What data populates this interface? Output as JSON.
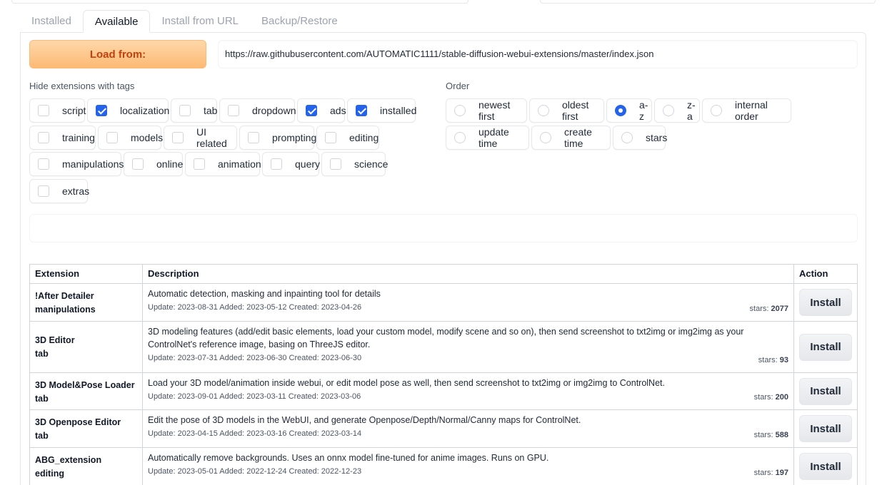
{
  "tabs": [
    {
      "label": "Installed"
    },
    {
      "label": "Available"
    },
    {
      "label": "Install from URL"
    },
    {
      "label": "Backup/Restore"
    }
  ],
  "load": {
    "button_label": "Load from:",
    "url": "https://raw.githubusercontent.com/AUTOMATIC1111/stable-diffusion-webui-extensions/master/index.json"
  },
  "hide_tags": {
    "label": "Hide extensions with tags",
    "items": [
      {
        "label": "script",
        "checked": false
      },
      {
        "label": "localization",
        "checked": true
      },
      {
        "label": "tab",
        "checked": false
      },
      {
        "label": "dropdown",
        "checked": false
      },
      {
        "label": "ads",
        "checked": true
      },
      {
        "label": "installed",
        "checked": true
      },
      {
        "label": "training",
        "checked": false
      },
      {
        "label": "models",
        "checked": false
      },
      {
        "label": "UI related",
        "checked": false
      },
      {
        "label": "prompting",
        "checked": false
      },
      {
        "label": "editing",
        "checked": false
      },
      {
        "label": "manipulations",
        "checked": false
      },
      {
        "label": "online",
        "checked": false
      },
      {
        "label": "animation",
        "checked": false
      },
      {
        "label": "query",
        "checked": false
      },
      {
        "label": "science",
        "checked": false
      },
      {
        "label": "extras",
        "checked": false
      }
    ]
  },
  "order": {
    "label": "Order",
    "selected": "a-z",
    "items": [
      {
        "label": "newest first"
      },
      {
        "label": "oldest first"
      },
      {
        "label": "a-z"
      },
      {
        "label": "z-a"
      },
      {
        "label": "internal order"
      },
      {
        "label": "update time"
      },
      {
        "label": "create time"
      },
      {
        "label": "stars"
      }
    ]
  },
  "table": {
    "headers": {
      "extension": "Extension",
      "description": "Description",
      "action": "Action"
    },
    "stars_label": "stars:",
    "install_label": "Install",
    "rows": [
      {
        "name": "!After Detailer",
        "tag": "manipulations",
        "description": "Automatic detection, masking and inpainting tool for details",
        "meta": "Update: 2023-08-31 Added: 2023-05-12 Created: 2023-04-26",
        "stars": "2077"
      },
      {
        "name": "3D Editor",
        "tag": "tab",
        "description": "3D modeling features (add/edit basic elements, load your custom model, modify scene and so on), then send screenshot to txt2img or img2img as your ControlNet's reference image, basing on ThreeJS editor.",
        "meta": "Update: 2023-07-31 Added: 2023-06-30 Created: 2023-06-30",
        "stars": "93"
      },
      {
        "name": "3D Model&Pose Loader",
        "tag": "tab",
        "description": "Load your 3D model/animation inside webui, or edit model pose as well, then send screenshot to txt2img or img2img to ControlNet.",
        "meta": "Update: 2023-09-01 Added: 2023-03-11 Created: 2023-03-06",
        "stars": "200"
      },
      {
        "name": "3D Openpose Editor",
        "tag": "tab",
        "description": "Edit the pose of 3D models in the WebUI, and generate Openpose/Depth/Normal/Canny maps for ControlNet.",
        "meta": "Update: 2023-04-15 Added: 2023-03-16 Created: 2023-03-14",
        "stars": "588"
      },
      {
        "name": "ABG_extension",
        "tag": "editing",
        "description": "Automatically remove backgrounds. Uses an onnx model fine-tuned for anime images. Runs on GPU.",
        "meta": "Update: 2023-05-01 Added: 2022-12-24 Created: 2022-12-23",
        "stars": "197"
      }
    ]
  }
}
